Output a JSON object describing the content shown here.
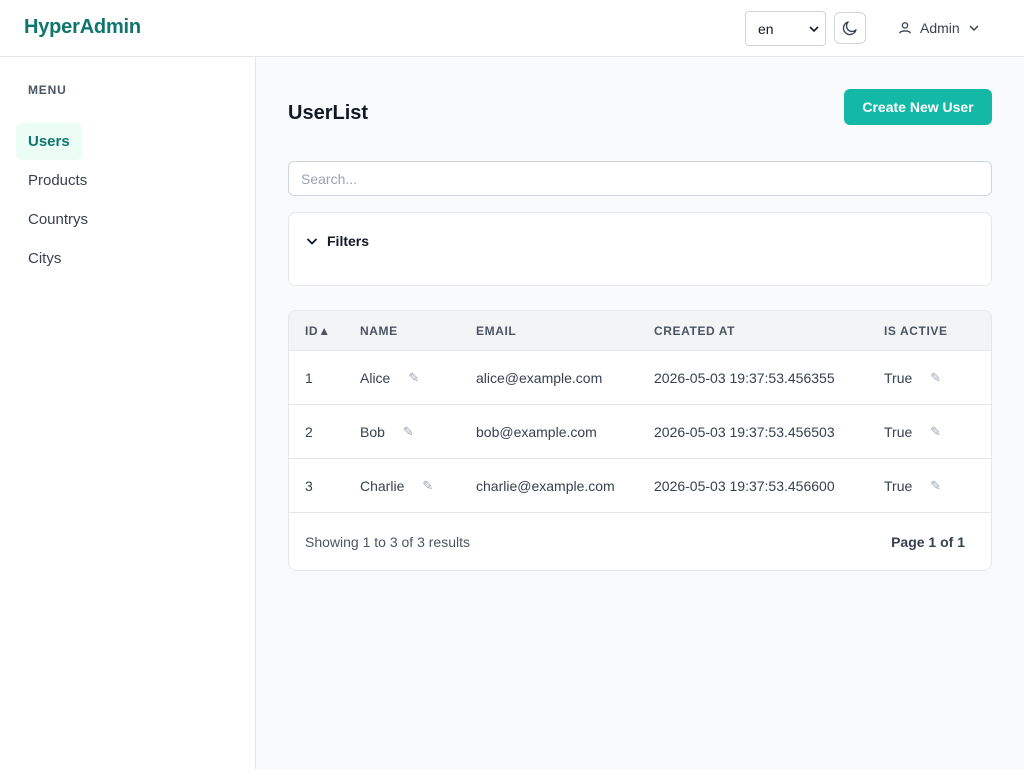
{
  "brand": "HyperAdmin",
  "header": {
    "language": "en",
    "user_label": "Admin"
  },
  "sidebar": {
    "heading": "MENU",
    "items": [
      {
        "label": "Users",
        "active": true
      },
      {
        "label": "Products",
        "active": false
      },
      {
        "label": "Countrys",
        "active": false
      },
      {
        "label": "Citys",
        "active": false
      }
    ]
  },
  "main": {
    "title": "UserList",
    "create_button": "Create New User",
    "search_placeholder": "Search...",
    "filters_label": "Filters",
    "table": {
      "columns": [
        "ID▲",
        "NAME",
        "EMAIL",
        "CREATED AT",
        "IS ACTIVE"
      ],
      "rows": [
        {
          "id": "1",
          "name": "Alice",
          "email": "alice@example.com",
          "created_at": "2026-05-03 19:37:53.456355",
          "is_active": "True"
        },
        {
          "id": "2",
          "name": "Bob",
          "email": "bob@example.com",
          "created_at": "2026-05-03 19:37:53.456503",
          "is_active": "True"
        },
        {
          "id": "3",
          "name": "Charlie",
          "email": "charlie@example.com",
          "created_at": "2026-05-03 19:37:53.456600",
          "is_active": "True"
        }
      ],
      "showing": "Showing 1 to 3 of 3 results",
      "page_info": "Page 1 of 1"
    }
  },
  "colors": {
    "brand": "#0f766e",
    "accent": "#14b8a6",
    "active_nav_bg": "#ecfdf5"
  },
  "icons": {
    "language_chevron": "chevron-down-icon",
    "theme_toggle": "moon-icon",
    "user": "user-icon",
    "user_chevron": "chevron-down-icon",
    "filters_toggle": "chevron-down-icon",
    "edit": "pencil-icon"
  }
}
